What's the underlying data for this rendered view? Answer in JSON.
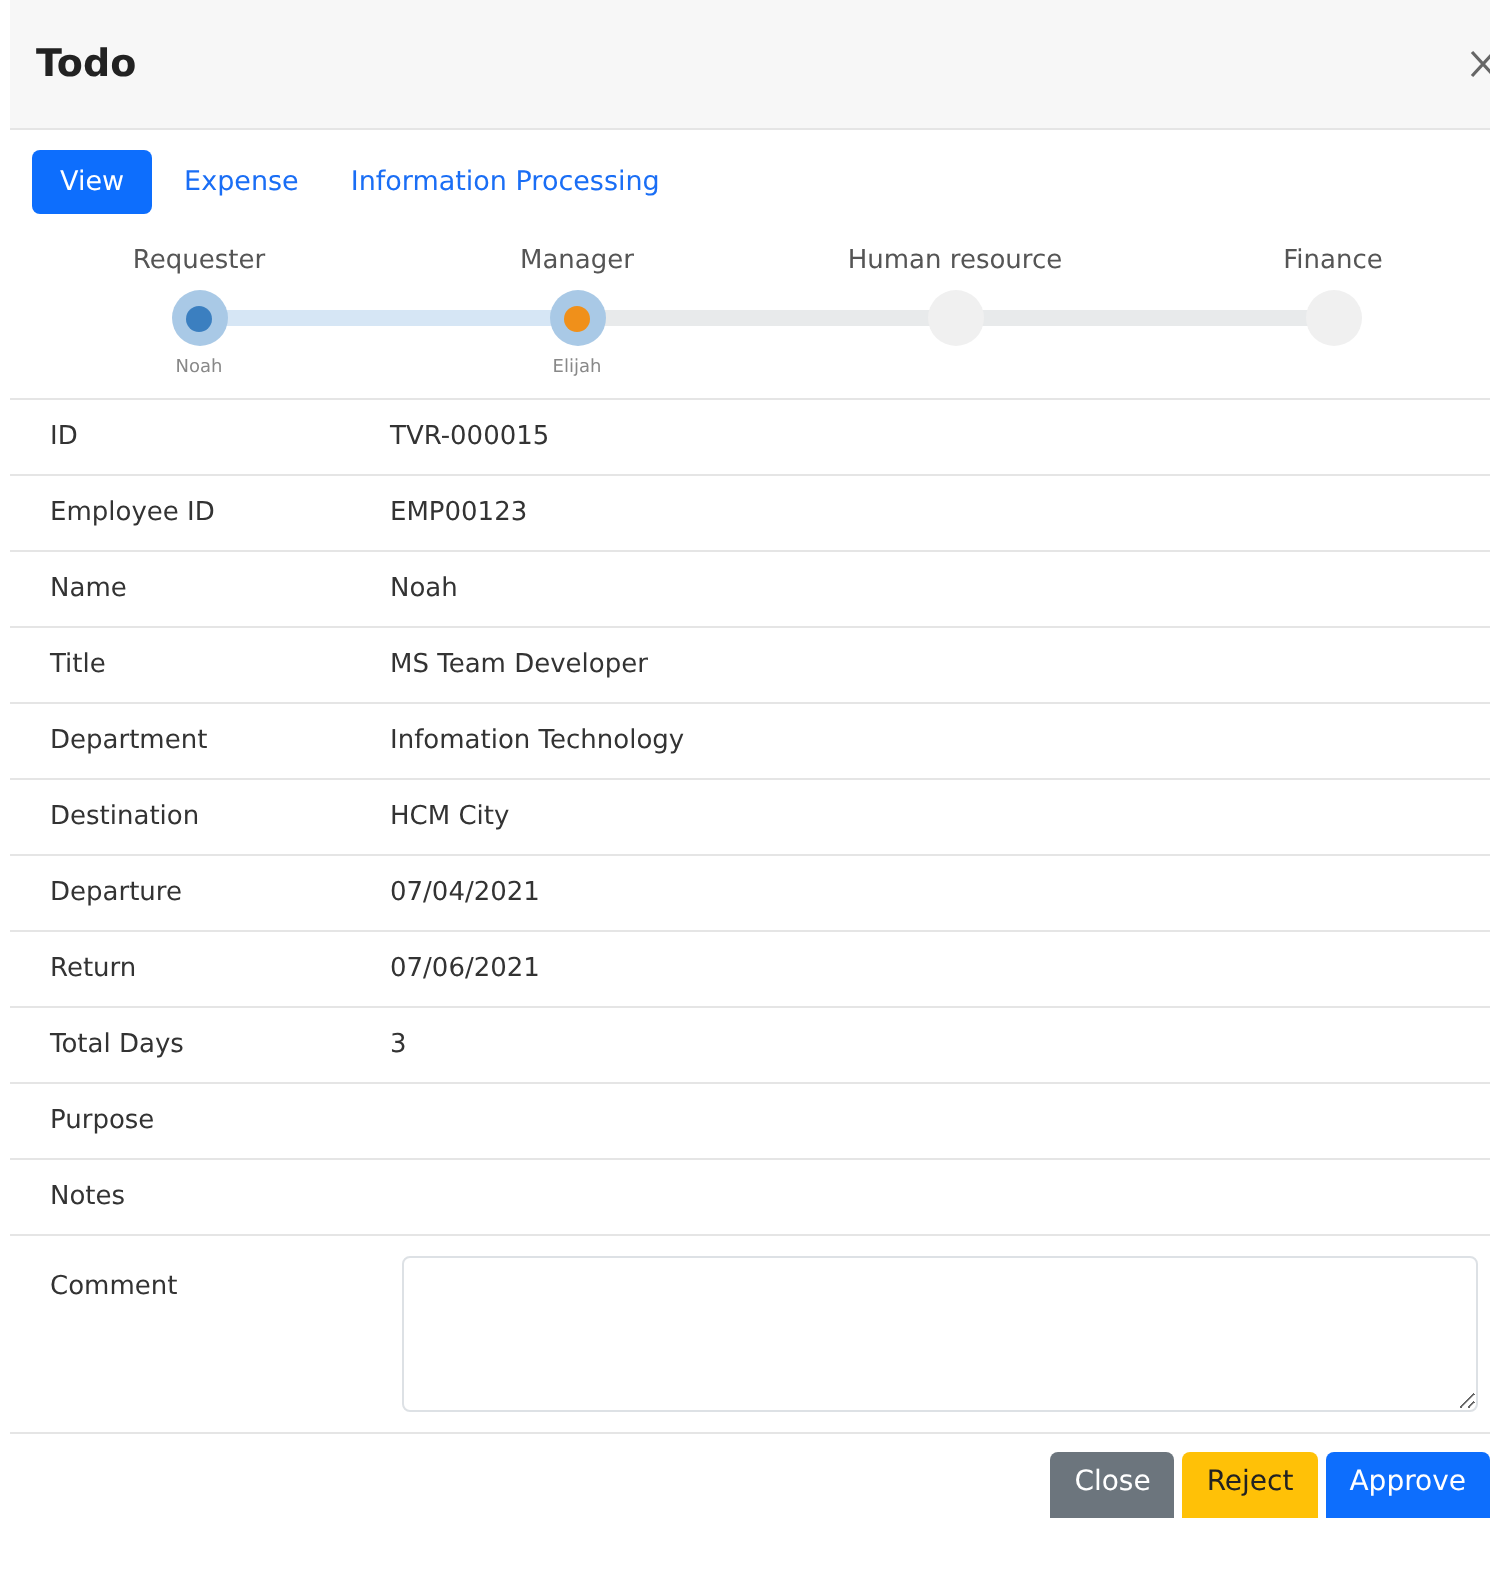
{
  "window": {
    "title": "Todo"
  },
  "tabs": [
    {
      "label": "View",
      "selected": true
    },
    {
      "label": "Expense",
      "selected": false
    },
    {
      "label": "Information Processing",
      "selected": false
    }
  ],
  "steps": [
    {
      "label": "Requester",
      "person": "Noah",
      "done": true,
      "current": false
    },
    {
      "label": "Manager",
      "person": "Elijah",
      "done": false,
      "current": true
    },
    {
      "label": "Human resource",
      "done": false,
      "current": false
    },
    {
      "label": "Finance",
      "done": false,
      "current": false
    }
  ],
  "fields": [
    {
      "label": "ID",
      "value": "TVR-000015"
    },
    {
      "label": "Employee ID",
      "value": "EMP00123"
    },
    {
      "label": "Name",
      "value": "Noah"
    },
    {
      "label": "Title",
      "value": "MS Team Developer"
    },
    {
      "label": "Department",
      "value": "Infomation Technology"
    },
    {
      "label": "Destination",
      "value": "HCM City"
    },
    {
      "label": "Departure",
      "value": "07/04/2021"
    },
    {
      "label": "Return",
      "value": "07/06/2021"
    },
    {
      "label": "Total Days",
      "value": "3"
    },
    {
      "label": "Purpose"
    },
    {
      "label": "Notes"
    }
  ],
  "comment": {
    "label": "Comment"
  },
  "buttons": [
    {
      "label": "Close",
      "kind": "secondary"
    },
    {
      "label": "Reject",
      "kind": "warning"
    },
    {
      "label": "Approve",
      "kind": "primary"
    }
  ]
}
